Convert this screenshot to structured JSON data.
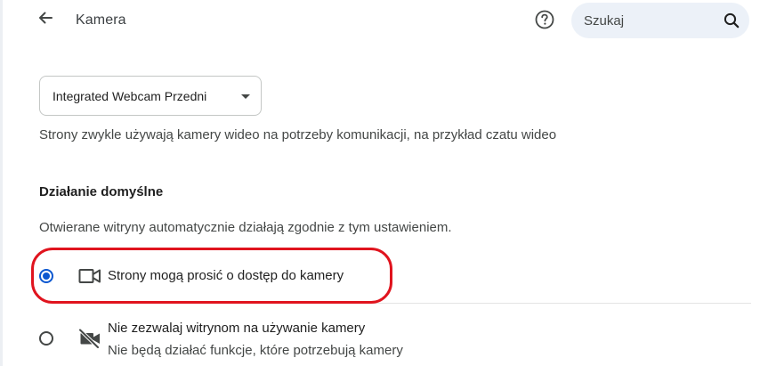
{
  "header": {
    "title": "Kamera",
    "back_icon": "arrow-back-icon",
    "help_icon": "help-circle-icon",
    "search": {
      "placeholder": "Szukaj",
      "value": "",
      "icon": "search-icon"
    }
  },
  "camera_select": {
    "selected": "Integrated Webcam Przedni",
    "icon": "dropdown-arrow-icon"
  },
  "description": "Strony zwykle używają kamery wideo na potrzeby komunikacji, na przykład czatu wideo",
  "default_behavior": {
    "heading": "Działanie domyślne",
    "description": "Otwierane witryny automatycznie działają zgodnie z tym ustawieniem.",
    "options": [
      {
        "label": "Strony mogą prosić o dostęp do kamery",
        "sublabel": "",
        "selected": true,
        "icon": "videocam-icon"
      },
      {
        "label": "Nie zezwalaj witrynom na używanie kamery",
        "sublabel": "Nie będą działać funkcje, które potrzebują kamery",
        "selected": false,
        "icon": "videocam-off-icon"
      }
    ]
  },
  "colors": {
    "accent": "#0b57d0",
    "annotation": "#e0141e",
    "search_bg": "#ecf1f8"
  }
}
